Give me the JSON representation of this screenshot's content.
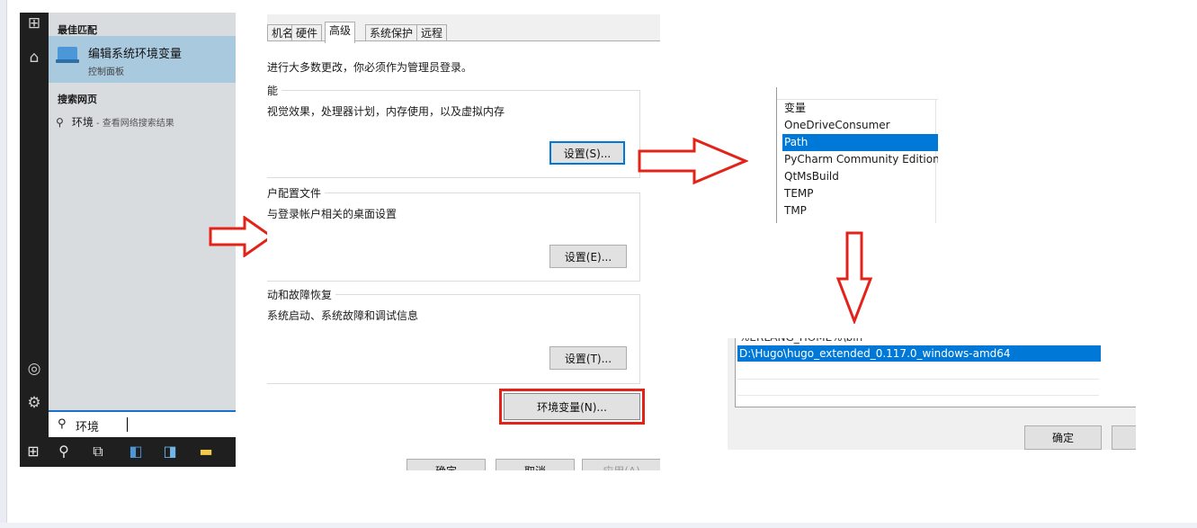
{
  "start_menu": {
    "best_match_header": "最佳匹配",
    "best_match": {
      "title": "编辑系统环境变量",
      "subtitle": "控制面板",
      "icon": "control-panel-icon"
    },
    "web_header": "搜索网页",
    "web_result": {
      "term": "环境",
      "suffix": " - 查看网络搜索结果"
    },
    "search_value": "环境",
    "rail_icons": [
      "apps-icon",
      "document-icon",
      "account-icon",
      "settings-icon"
    ],
    "taskbar_icons": [
      "windows-icon",
      "search-icon",
      "task-view-icon",
      "app-icon",
      "terminal-icon",
      "file-explorer-icon"
    ]
  },
  "system_properties": {
    "tabs": [
      "机名",
      "硬件",
      "高级",
      "系统保护",
      "远程"
    ],
    "active_tab": "高级",
    "admin_note": "进行大多数更改，你必须作为管理员登录。",
    "groups": [
      {
        "label": "能",
        "desc": "视觉效果，处理器计划，内存使用，以及虚拟内存",
        "button": "设置(S)..."
      },
      {
        "label": "户配置文件",
        "desc": "与登录帐户相关的桌面设置",
        "button": "设置(E)..."
      },
      {
        "label": "动和故障恢复",
        "desc": "系统启动、系统故障和调试信息",
        "button": "设置(T)..."
      }
    ],
    "env_button": "环境变量(N)...",
    "footer_buttons": [
      "确定",
      "取消",
      "应用(A)"
    ]
  },
  "env_vars": {
    "header": "变量",
    "items": [
      "OneDriveConsumer",
      "Path",
      "PyCharm Community Edition",
      "QtMsBuild",
      "TEMP",
      "TMP"
    ],
    "selected_index": 1
  },
  "path_edit": {
    "truncated_entry": "%ERLANG_HOME%\\bin",
    "selected_entry": "D:\\Hugo\\hugo_extended_0.117.0_windows-amd64",
    "ok_button": "确定"
  },
  "colors": {
    "arrow": "#e2231a",
    "selection": "#0078d7",
    "focus": "#0078d7"
  }
}
